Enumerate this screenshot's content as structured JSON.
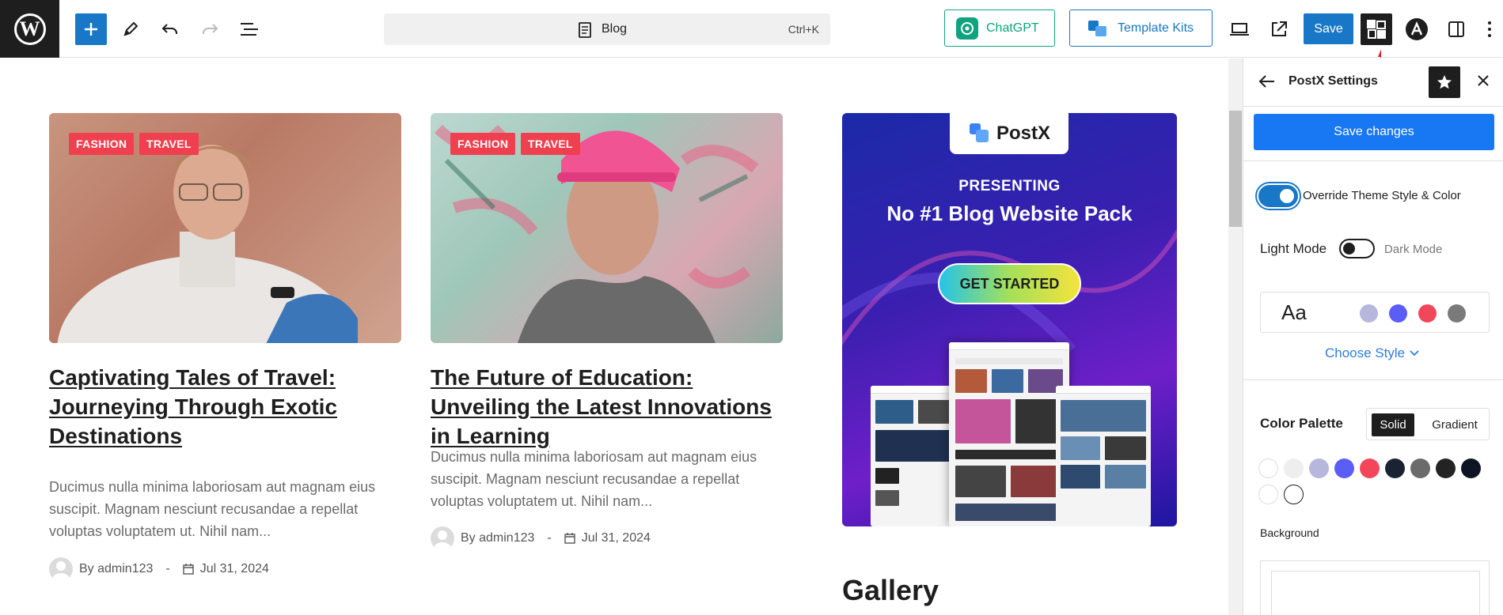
{
  "toolbar": {
    "document_title": "Blog",
    "shortcut": "Ctrl+K",
    "chatgpt_label": "ChatGPT",
    "template_kits_label": "Template Kits",
    "save_label": "Save"
  },
  "posts": [
    {
      "tags": [
        "FASHION",
        "TRAVEL"
      ],
      "title": "Captivating Tales of Travel: Journeying Through Exotic Destinations",
      "excerpt": "Ducimus nulla minima laboriosam aut magnam eius suscipit. Magnam nesciunt recusandae a repellat voluptas voluptatem ut. Nihil nam...",
      "author": "By admin123",
      "separator": "-",
      "date": "Jul 31, 2024"
    },
    {
      "tags": [
        "FASHION",
        "TRAVEL"
      ],
      "title": "The Future of Education: Unveiling the Latest Innovations in Learning",
      "excerpt": "Ducimus nulla minima laboriosam aut magnam eius suscipit. Magnam nesciunt recusandae a repellat voluptas voluptatem ut. Nihil nam...",
      "author": "By admin123",
      "separator": "-",
      "date": "Jul 31, 2024"
    }
  ],
  "ad": {
    "logo": "PostX",
    "presenting": "PRESENTING",
    "headline": "No #1 Blog Website Pack",
    "cta": "GET STARTED"
  },
  "gallery_heading": "Gallery",
  "panel": {
    "title": "PostX Settings",
    "save_changes": "Save changes",
    "override_label": "Override Theme Style & Color",
    "light_mode": "Light Mode",
    "dark_mode": "Dark Mode",
    "typography_sample": "Aa",
    "preview_colors": [
      "#b7b6dd",
      "#5b5ef6",
      "#f2475a",
      "#7a7a7a"
    ],
    "choose_style": "Choose Style",
    "color_palette_label": "Color Palette",
    "solid_label": "Solid",
    "gradient_label": "Gradient",
    "palette": [
      "#ffffff",
      "#eeeeee",
      "#b7b6dd",
      "#5b5ef6",
      "#f2475a",
      "#1a2233",
      "#6b6b6b",
      "#232323",
      "#0d1424",
      "#ffffff",
      "#ffffff"
    ],
    "background_label": "Background"
  },
  "colors": {
    "accent_blue": "#1877c6",
    "tag_red": "#f0404f",
    "chatgpt_green": "#10a37f"
  }
}
